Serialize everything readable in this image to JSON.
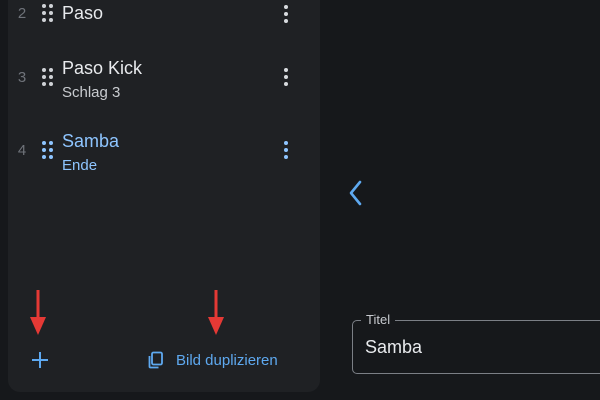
{
  "list": {
    "items": [
      {
        "number": "2",
        "title": "Paso",
        "subtitle": ""
      },
      {
        "number": "3",
        "title": "Paso Kick",
        "subtitle": "Schlag 3"
      },
      {
        "number": "4",
        "title": "Samba",
        "subtitle": "Ende",
        "selected": true
      }
    ]
  },
  "footer": {
    "add_icon": "plus-icon",
    "duplicate_icon": "copy-icon",
    "duplicate_label": "Bild duplizieren"
  },
  "editor": {
    "back_icon": "chevron-left-icon",
    "title_field": {
      "label": "Titel",
      "value": "Samba"
    }
  },
  "colors": {
    "accent": "#8ec5ff",
    "link": "#5ea9f0",
    "annotation_arrow": "#e53935",
    "panel": "#1f2124",
    "background": "#16181b"
  }
}
